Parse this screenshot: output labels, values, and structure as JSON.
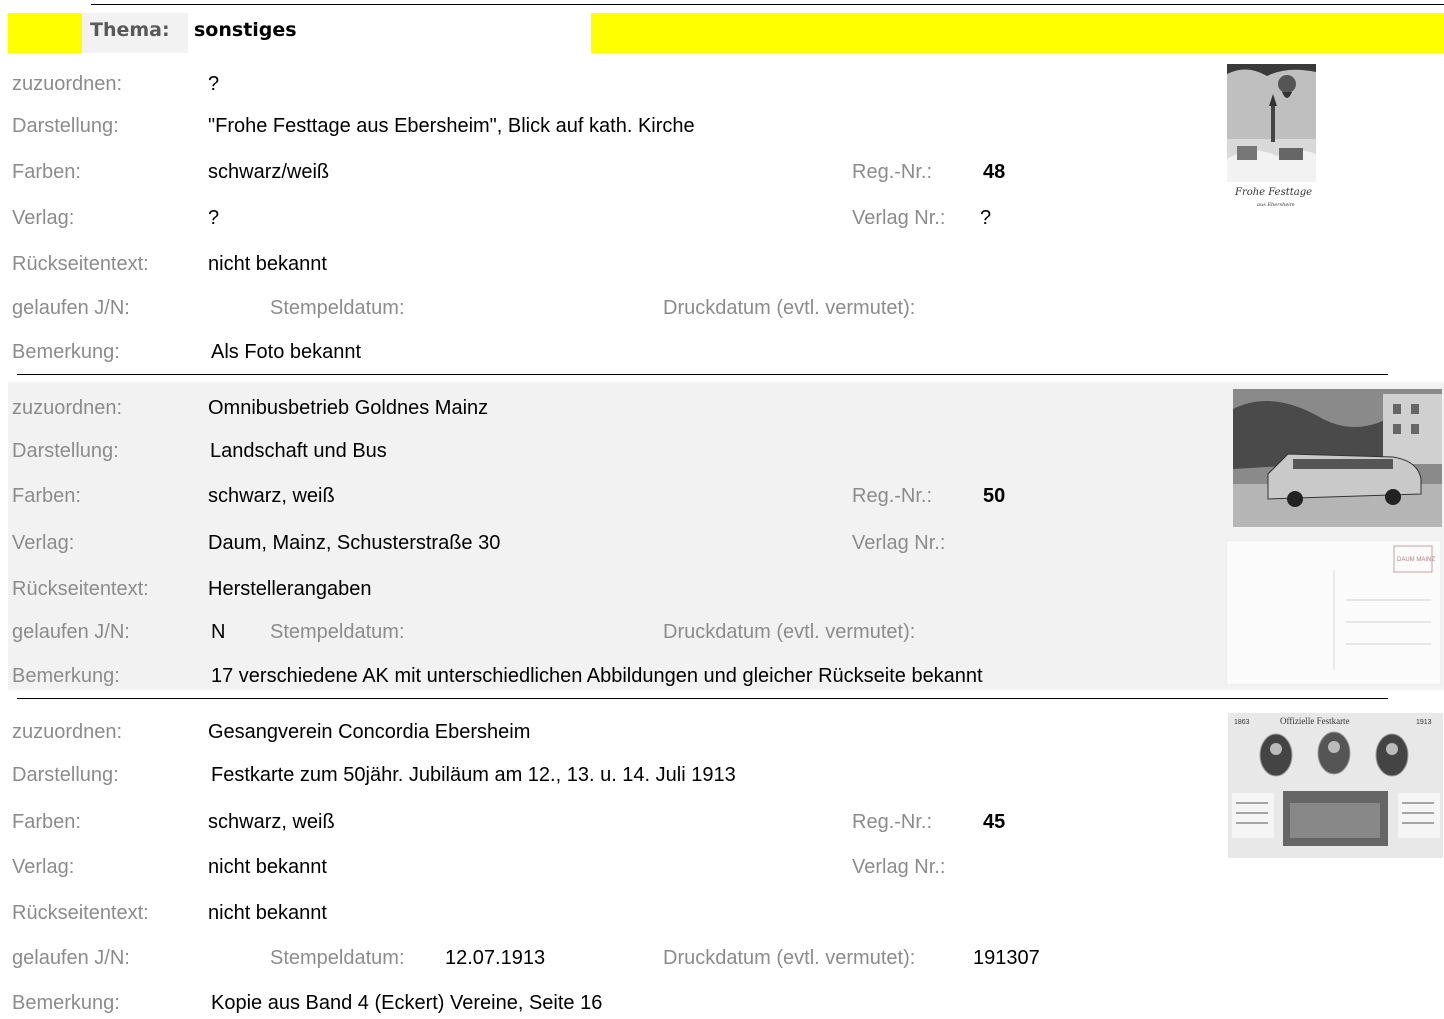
{
  "header": {
    "theme_label": "Thema:",
    "theme_value": "sonstiges"
  },
  "labels": {
    "zuzuordnen": "zuzuordnen:",
    "darstellung": "Darstellung:",
    "farben": "Farben:",
    "verlag": "Verlag:",
    "rueckseite": "Rückseitentext:",
    "gelaufen": "gelaufen J/N:",
    "stempel": "Stempeldatum:",
    "druck": "Druckdatum (evtl. vermutet):",
    "bemerkung": "Bemerkung:",
    "regnr": "Reg.-Nr.:",
    "verlagnr": "Verlag Nr.:"
  },
  "cards": [
    {
      "zuzuordnen": "?",
      "darstellung": "\"Frohe Festtage aus Ebersheim\", Blick auf kath. Kirche",
      "farben": "schwarz/weiß",
      "regnr": "48",
      "verlag": "?",
      "verlagnr": "?",
      "rueckseite": "nicht bekannt",
      "gelaufen": "",
      "stempel": "",
      "druck": "",
      "bemerkung": "Als Foto bekannt",
      "image_caption": "Frohe Festtage",
      "image_caption2": "aus Ebersheim"
    },
    {
      "zuzuordnen": "Omnibusbetrieb Goldnes Mainz",
      "darstellung": "Landschaft und Bus",
      "farben": "schwarz, weiß",
      "regnr": "50",
      "verlag": "Daum, Mainz, Schusterstraße 30",
      "verlagnr": "",
      "rueckseite": "Herstellerangaben",
      "gelaufen": "N",
      "stempel": "",
      "druck": "",
      "bemerkung": "17 verschiedene AK mit unterschiedlichen Abbildungen und gleicher Rückseite bekannt",
      "stamp_text": "DAUM MAINZ"
    },
    {
      "zuzuordnen": "Gesangverein Concordia Ebersheim",
      "darstellung": "Festkarte zum 50jähr. Jubiläum am 12., 13. u. 14. Juli 1913",
      "farben": "schwarz, weiß",
      "regnr": "45",
      "verlag": "nicht bekannt",
      "verlagnr": "",
      "rueckseite": "nicht bekannt",
      "gelaufen": "",
      "stempel": "12.07.1913",
      "druck": "191307",
      "bemerkung": "Kopie aus Band 4 (Eckert) Vereine, Seite 16",
      "image_title": "Offizielle Festkarte",
      "image_year_left": "1863",
      "image_year_right": "1913"
    }
  ],
  "colors": {
    "theme_bar": "#ffff00",
    "label_gray": "#8c8c8c",
    "shade": "#f2f2f2"
  }
}
